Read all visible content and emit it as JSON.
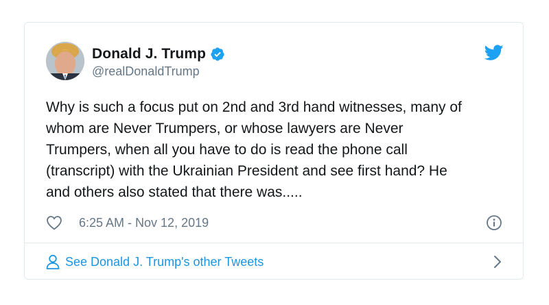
{
  "tweet": {
    "author": {
      "display_name": "Donald J. Trump",
      "handle": "@realDonaldTrump",
      "verified": true
    },
    "text": "Why is such a focus put on 2nd and 3rd hand witnesses, many of\nwhom are Never Trumpers, or whose lawyers are Never\nTrumpers, when all you have to do is read the phone call\n(transcript) with the Ukrainian President and see first hand? He\nand others also stated that there was.....",
    "timestamp": "6:25 AM - Nov 12, 2019"
  },
  "footer": {
    "other_tweets_label": "See Donald J. Trump's other Tweets"
  },
  "icons": {
    "verified": "verified-badge-icon",
    "brand": "twitter-bird-icon",
    "like": "heart-icon",
    "info": "info-icon",
    "person": "person-icon",
    "chevron": "chevron-right-icon"
  },
  "colors": {
    "brand_blue": "#1da1f2",
    "link_blue": "#1b95e0",
    "text": "#14171a",
    "secondary_text": "#657786",
    "border": "#e1e8ed"
  }
}
